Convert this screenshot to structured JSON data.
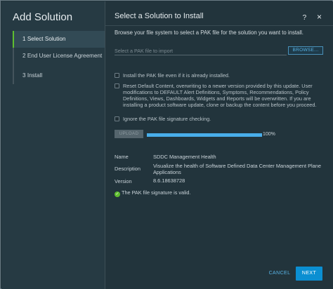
{
  "wizard": {
    "title": "Add Solution",
    "steps": [
      {
        "label": "1 Select Solution",
        "active": true
      },
      {
        "label": "2 End User License Agreement",
        "active": false
      },
      {
        "label": "3 Install",
        "active": false
      }
    ]
  },
  "panel": {
    "title": "Select a Solution to Install",
    "help_icon": "?",
    "close_icon": "×",
    "browse_text": "Browse your file system to select a PAK file for the solution you want to install.",
    "file_input_placeholder": "Select a PAK file to import",
    "browse_label": "BROWSE...",
    "options": [
      {
        "label": "Install the PAK file even if it is already installed.",
        "checked": false
      },
      {
        "label": "Reset Default Content, overwriting to a newer version provided by this update. User modifications to DEFAULT Alert Definitions, Symptoms, Recommendations, Policy Definitions, Views, Dashboards, Widgets and Reports will be overwritten. If you are installing a product software update, clone or backup the content before you proceed.",
        "checked": false
      },
      {
        "label": "Ignore the PAK file signature checking.",
        "checked": false
      }
    ],
    "upload_label": "UPLOAD",
    "progress": {
      "value": 100,
      "text": "100%"
    },
    "info": {
      "name_key": "Name",
      "name_val": "SDDC Management Health",
      "description_key": "Description",
      "description_val": "Visualize the health of Software Defined Data Center Management Plane Applications",
      "version_key": "Version",
      "version_val": "8.6.18638728"
    },
    "signature_text": "The PAK file signature is valid.",
    "cancel_label": "CANCEL",
    "next_label": "NEXT"
  },
  "colors": {
    "accent": "#0b8fd2",
    "success": "#5fbe2f",
    "progress": "#49aeea"
  }
}
